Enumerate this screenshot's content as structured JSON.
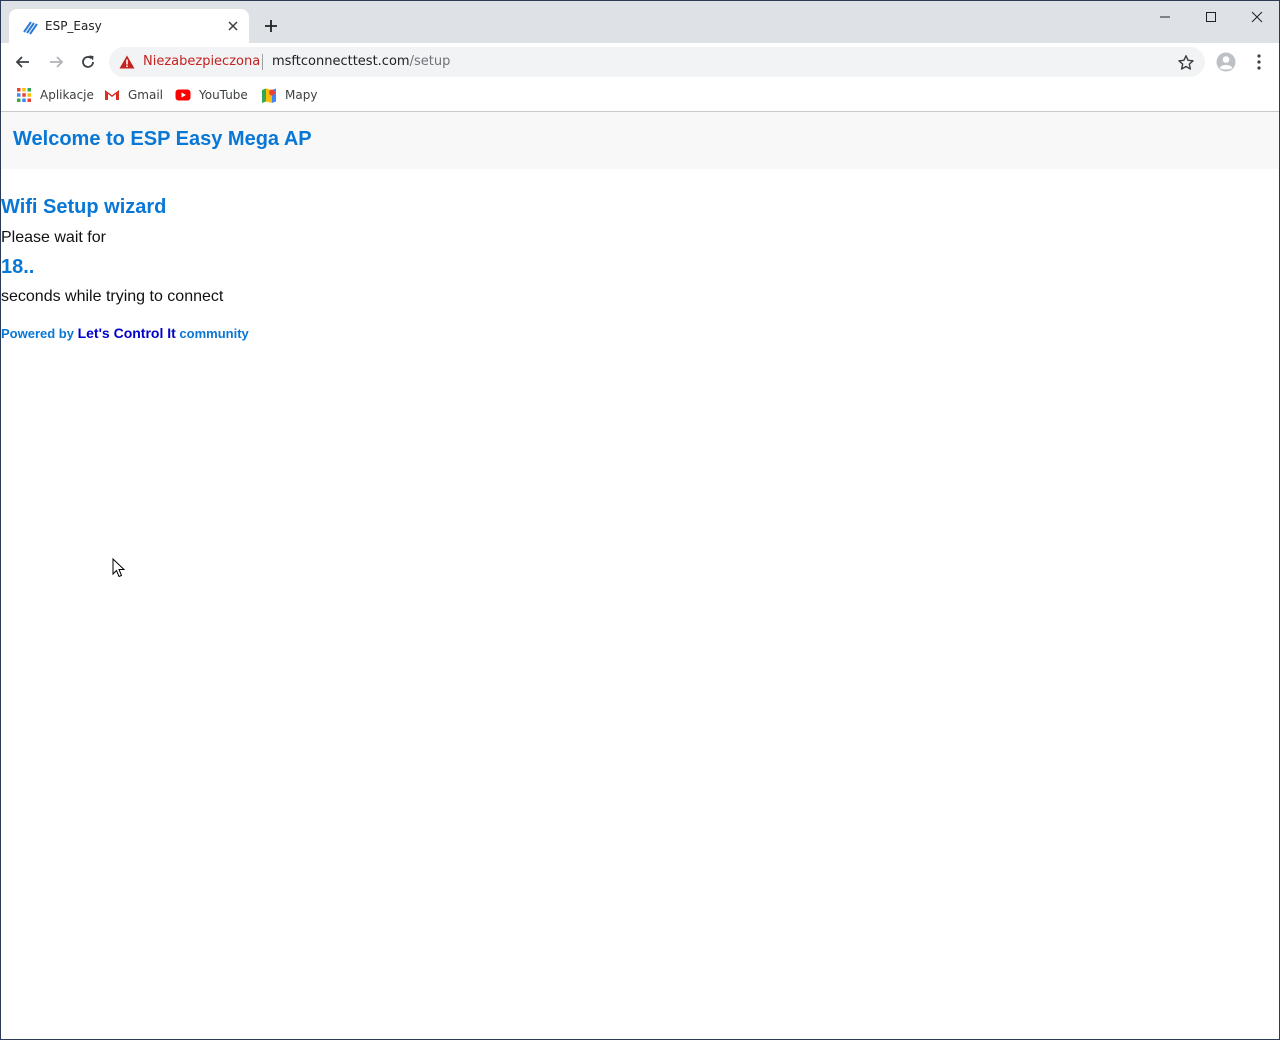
{
  "browser": {
    "tab_title": "ESP_Easy",
    "address": {
      "security_label": "Niezabezpieczona",
      "host": "msftconnecttest.com",
      "path": "/setup"
    },
    "bookmarks": [
      {
        "label": "Aplikacje",
        "icon": "apps-grid-icon"
      },
      {
        "label": "Gmail",
        "icon": "gmail-icon"
      },
      {
        "label": "YouTube",
        "icon": "youtube-icon"
      },
      {
        "label": "Mapy",
        "icon": "maps-icon"
      }
    ]
  },
  "page": {
    "header_title": "Welcome to ESP Easy Mega AP",
    "wizard_title": "Wifi Setup wizard",
    "wait_text": "Please wait for",
    "countdown": "18..",
    "seconds_text": "seconds while trying to connect",
    "footer": {
      "prefix": "Powered by ",
      "link": "Let's Control It",
      "suffix": " community"
    }
  },
  "colors": {
    "accent": "#0877d5",
    "link": "#0000cc",
    "insecure": "#c5221f"
  }
}
